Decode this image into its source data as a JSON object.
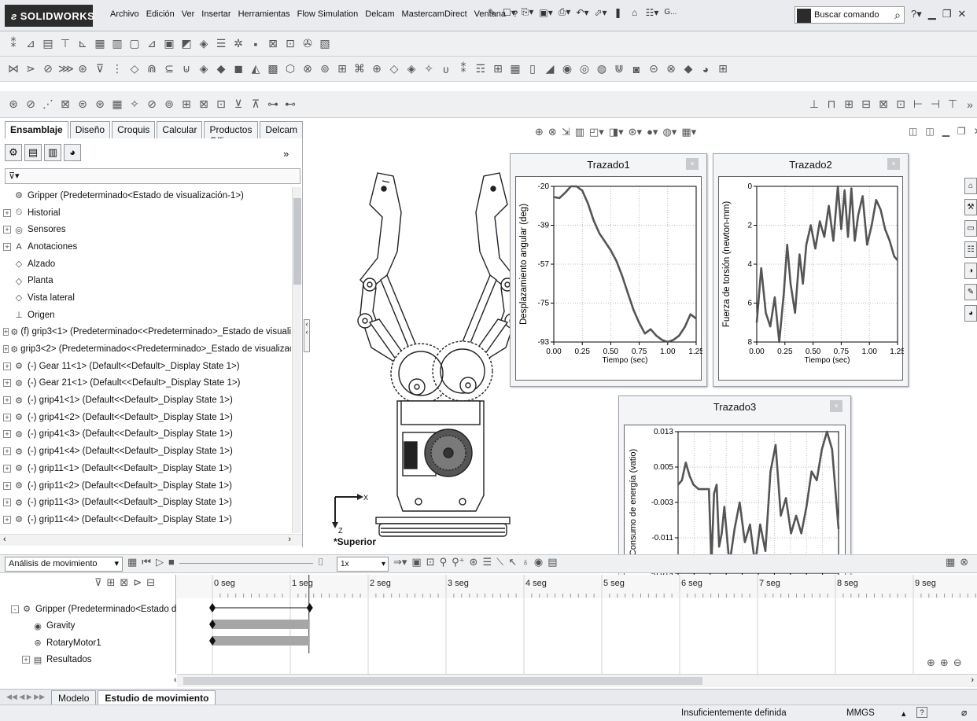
{
  "app": {
    "logo_text": "SOLIDWORKS"
  },
  "menu": [
    "Archivo",
    "Edición",
    "Ver",
    "Insertar",
    "Herramientas",
    "Flow Simulation",
    "Delcam",
    "MastercamDirect",
    "Ventana",
    "?"
  ],
  "quick_access": {
    "more_label": "G...",
    "search_placeholder": "Buscar comando"
  },
  "command_tabs": [
    {
      "label": "Ensamblaje",
      "active": true
    },
    {
      "label": "Diseño",
      "active": false
    },
    {
      "label": "Croquis",
      "active": false
    },
    {
      "label": "Calcular",
      "active": false
    },
    {
      "label": "Productos Office",
      "active": false
    },
    {
      "label": "Delcam",
      "active": false
    }
  ],
  "feature_tree": {
    "items": [
      {
        "label": "Gripper  (Predeterminado<Estado de visualización-1>)",
        "icon": "assembly-icon",
        "expander": ""
      },
      {
        "label": "Historial",
        "icon": "history-icon",
        "expander": "+"
      },
      {
        "label": "Sensores",
        "icon": "sensor-icon",
        "expander": "+"
      },
      {
        "label": "Anotaciones",
        "icon": "annotation-icon",
        "expander": "+"
      },
      {
        "label": "Alzado",
        "icon": "plane-icon",
        "expander": ""
      },
      {
        "label": "Planta",
        "icon": "plane-icon",
        "expander": ""
      },
      {
        "label": "Vista lateral",
        "icon": "plane-icon",
        "expander": ""
      },
      {
        "label": "Origen",
        "icon": "origin-icon",
        "expander": ""
      },
      {
        "label": "(f) grip3<1> (Predeterminado<<Predeterminado>_Estado de visuali",
        "icon": "part-icon",
        "expander": "+"
      },
      {
        "label": "grip3<2> (Predeterminado<<Predeterminado>_Estado de visualizac",
        "icon": "part-icon",
        "expander": "+"
      },
      {
        "label": "(-) Gear 11<1> (Default<<Default>_Display State 1>)",
        "icon": "part-icon",
        "expander": "+"
      },
      {
        "label": "(-) Gear 21<1> (Default<<Default>_Display State 1>)",
        "icon": "part-icon",
        "expander": "+"
      },
      {
        "label": "(-) grip41<1> (Default<<Default>_Display State 1>)",
        "icon": "part-icon",
        "expander": "+"
      },
      {
        "label": "(-) grip41<2> (Default<<Default>_Display State 1>)",
        "icon": "part-icon",
        "expander": "+"
      },
      {
        "label": "(-) grip41<3> (Default<<Default>_Display State 1>)",
        "icon": "part-icon",
        "expander": "+"
      },
      {
        "label": "(-) grip41<4> (Default<<Default>_Display State 1>)",
        "icon": "part-icon",
        "expander": "+"
      },
      {
        "label": "(-) grip11<1> (Default<<Default>_Display State 1>)",
        "icon": "part-icon",
        "expander": "+"
      },
      {
        "label": "(-) grip11<2> (Default<<Default>_Display State 1>)",
        "icon": "part-icon",
        "expander": "+"
      },
      {
        "label": "(-) grip11<3> (Default<<Default>_Display State 1>)",
        "icon": "part-icon",
        "expander": "+"
      },
      {
        "label": "(-) grip11<4> (Default<<Default>_Display State 1>)",
        "icon": "part-icon",
        "expander": "+"
      }
    ]
  },
  "view": {
    "orientation_label": "*Superior",
    "triad_x": "X",
    "triad_z": "Z"
  },
  "chart_data": [
    {
      "type": "line",
      "window_title": "Trazado1",
      "xlabel": "Tiempo (sec)",
      "ylabel": "Desplazamiento angular (deg)",
      "xticks": [
        "0.00",
        "0.25",
        "0.50",
        "0.75",
        "1.00",
        "1.25"
      ],
      "yticks": [
        "-20",
        "-39",
        "-57",
        "-75",
        "-93"
      ],
      "xlim": [
        0,
        1.25
      ],
      "ylim": [
        -93,
        -20
      ],
      "grid": true,
      "x": [
        0,
        0.05,
        0.1,
        0.15,
        0.2,
        0.25,
        0.3,
        0.35,
        0.4,
        0.45,
        0.5,
        0.55,
        0.6,
        0.65,
        0.7,
        0.75,
        0.8,
        0.85,
        0.9,
        0.95,
        1.0,
        1.05,
        1.1,
        1.15,
        1.2,
        1.25
      ],
      "y": [
        -25,
        -25.5,
        -23,
        -20,
        -20,
        -22,
        -28,
        -36,
        -42,
        -46,
        -50,
        -55,
        -62,
        -70,
        -78,
        -84,
        -89,
        -87,
        -90,
        -92,
        -93,
        -92,
        -90,
        -86,
        -80,
        -82
      ]
    },
    {
      "type": "line",
      "window_title": "Trazado2",
      "xlabel": "Tiempo (sec)",
      "ylabel": "Fuerza de torsión (newton-mm)",
      "xticks": [
        "0.00",
        "0.25",
        "0.50",
        "0.75",
        "1.00",
        "1.25"
      ],
      "yticks": [
        "0",
        "2",
        "4",
        "6",
        "8"
      ],
      "xlim": [
        0,
        1.25
      ],
      "ylim": [
        0,
        8
      ],
      "grid": true,
      "x": [
        0,
        0.04,
        0.08,
        0.12,
        0.16,
        0.2,
        0.24,
        0.27,
        0.3,
        0.34,
        0.38,
        0.41,
        0.44,
        0.48,
        0.52,
        0.56,
        0.6,
        0.64,
        0.68,
        0.72,
        0.75,
        0.78,
        0.81,
        0.84,
        0.87,
        0.9,
        0.94,
        0.98,
        1.02,
        1.06,
        1.1,
        1.14,
        1.18,
        1.22,
        1.25
      ],
      "y": [
        1,
        3.8,
        1.5,
        0.8,
        2.3,
        0,
        2.5,
        5,
        3,
        1.5,
        4.5,
        3,
        5,
        6,
        4.8,
        6.2,
        5.4,
        7,
        5.2,
        8,
        5.8,
        7.8,
        5.4,
        7.9,
        5.2,
        6.5,
        7.5,
        5,
        6,
        7.3,
        6.8,
        5.8,
        5.2,
        4.4,
        4.2
      ]
    },
    {
      "type": "line",
      "window_title": "Trazado3",
      "xlabel": "Tiempo (sec)",
      "ylabel": "Consumo de energía (vatio)",
      "xticks": [
        "0.00",
        "0.13",
        "0.25",
        "0.38",
        "0.50",
        "0.63",
        "0.75",
        "0.88",
        "1.00",
        "1.13",
        "1.25"
      ],
      "yticks": [
        "0.013",
        "0.005",
        "-0.003",
        "-0.011",
        "-0.019"
      ],
      "xlim": [
        0,
        1.25
      ],
      "ylim": [
        -0.019,
        0.013
      ],
      "grid": true,
      "x": [
        0,
        0.03,
        0.06,
        0.09,
        0.12,
        0.16,
        0.2,
        0.24,
        0.26,
        0.28,
        0.3,
        0.32,
        0.34,
        0.36,
        0.4,
        0.44,
        0.48,
        0.52,
        0.56,
        0.6,
        0.64,
        0.68,
        0.72,
        0.76,
        0.8,
        0.84,
        0.88,
        0.92,
        0.96,
        1.0,
        1.04,
        1.08,
        1.12,
        1.16,
        1.2,
        1.25
      ],
      "y": [
        0.001,
        0.002,
        0.006,
        0.003,
        0.001,
        0.0,
        0.0,
        0.0,
        -0.017,
        -0.001,
        0.001,
        -0.013,
        -0.01,
        -0.004,
        -0.017,
        -0.009,
        -0.003,
        -0.012,
        -0.008,
        -0.017,
        -0.008,
        -0.014,
        0.004,
        0.01,
        -0.006,
        -0.002,
        -0.01,
        -0.006,
        -0.01,
        -0.004,
        0.004,
        0.002,
        0.009,
        0.013,
        0.009,
        -0.009
      ]
    }
  ],
  "motion_study": {
    "study_type": "Análisis de movimiento",
    "playback_speed": "1x",
    "tree": [
      {
        "label": "Gripper  (Predeterminado<Estado d",
        "icon": "assembly-icon",
        "expander": "-"
      },
      {
        "label": "Gravity",
        "icon": "gravity-icon",
        "expander": ""
      },
      {
        "label": "RotaryMotor1",
        "icon": "motor-icon",
        "expander": ""
      },
      {
        "label": "Resultados",
        "icon": "results-icon",
        "expander": "+"
      }
    ],
    "time_labels": [
      "0 seg",
      "1 seg",
      "2 seg",
      "3 seg",
      "4 seg",
      "5 seg",
      "6 seg",
      "7 seg",
      "8 seg",
      "9 seg"
    ],
    "time_label_positions_sec": [
      0,
      1,
      2,
      3,
      4,
      5,
      6,
      7,
      8,
      9
    ],
    "keyframe_end_sec": 1.25
  },
  "bottom_tabs": [
    {
      "label": "Modelo",
      "active": false
    },
    {
      "label": "Estudio de movimiento",
      "active": true
    }
  ],
  "status": {
    "definition": "Insuficientemente definida",
    "units": "MMGS",
    "help": "?"
  }
}
